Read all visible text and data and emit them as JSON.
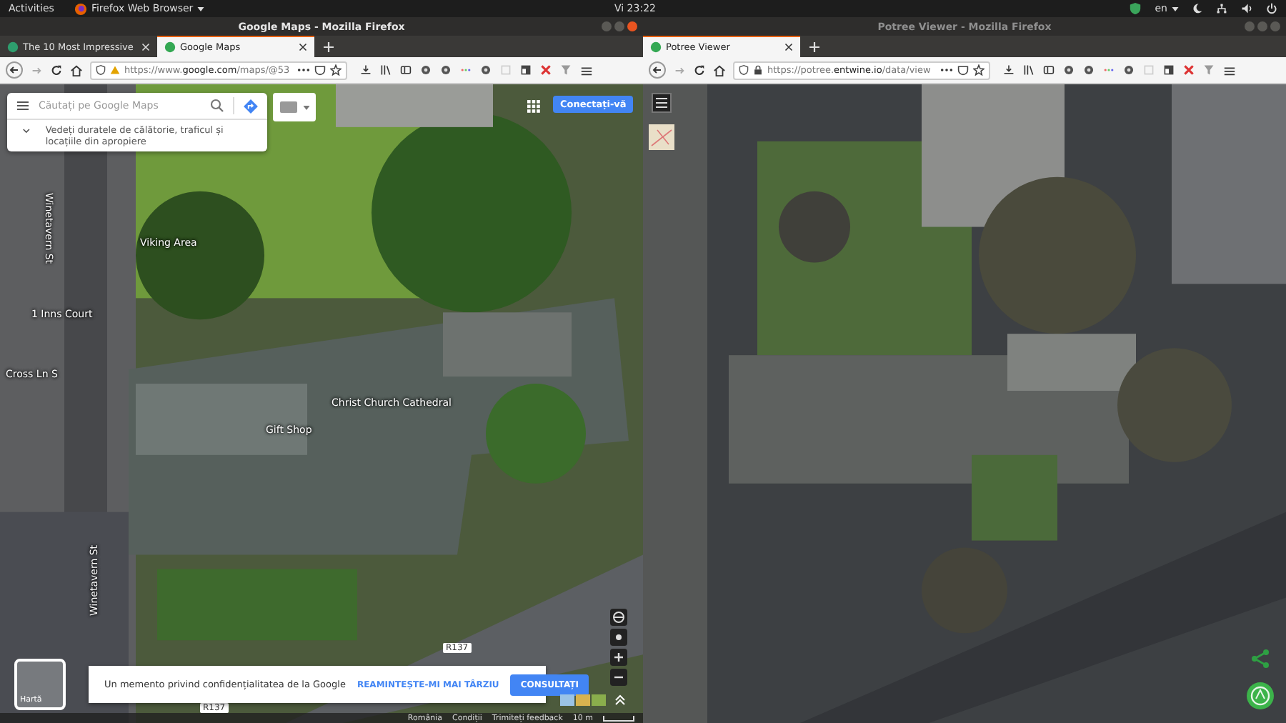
{
  "top_bar": {
    "activities": "Activities",
    "app_menu": "Firefox Web Browser",
    "clock": "Vi 23:22",
    "language": "en"
  },
  "windows": [
    {
      "kind": "google",
      "title": "Google Maps - Mozilla Firefox",
      "focused": true,
      "tabs": [
        {
          "label": "The 10 Most Impressive",
          "selected": false
        },
        {
          "label": "Google Maps",
          "selected": true
        }
      ],
      "url": "https://www.**google.com**/maps/@53",
      "search": {
        "placeholder": "Căutați pe Google Maps"
      },
      "hint": "Vedeți duratele de călătorie, traficul și locațiile din apropiere",
      "sign_in": "Conectați-vă",
      "map_labels": [
        {
          "text": "Viking Area"
        },
        {
          "text": "1 Inns Court"
        },
        {
          "text": "Cross Ln S"
        },
        {
          "text": "Christ Church Cathedral"
        },
        {
          "text": "Gift Shop"
        },
        {
          "text": "Winetavern St"
        },
        {
          "text": "Winetavern St"
        },
        {
          "text": "R137"
        },
        {
          "text": "R137"
        }
      ],
      "layer_thumbnail": "Hartă",
      "privacy": {
        "text": "Un memento privind confidențialitatea de la Google",
        "later": "REAMINTEȘTE-MI MAI TÂRZIU",
        "review": "CONSULTAȚI"
      },
      "footer": [
        "România",
        "Condiții",
        "Trimiteți feedback",
        "10 m"
      ]
    },
    {
      "kind": "potree",
      "title": "Potree Viewer - Mozilla Firefox",
      "focused": false,
      "tabs": [
        {
          "label": "Potree Viewer",
          "selected": true
        }
      ],
      "url": "https://potree.**entwine.io**/data/view"
    }
  ]
}
